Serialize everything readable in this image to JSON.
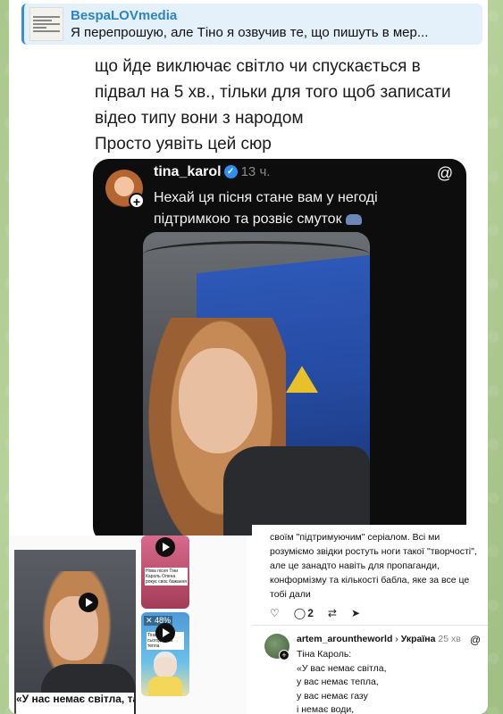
{
  "reply": {
    "author": "BespaLOVmedia",
    "snippet": "Я перепрошую, але Тіно я озвучив те, що пишуть в мер..."
  },
  "screenshot_text": {
    "line1": "що йде виключає світло чи спускається в",
    "line2": "підвал на 5 хв., тільки для того щоб записати",
    "line3": "відео типу вони з народом",
    "line4": "Просто уявіть цей сюр"
  },
  "threads_post": {
    "username": "tina_karol",
    "time": "13 ч.",
    "body": "Нехай ця пісня стане вам у негоді підтримкою та розвіє смуток"
  },
  "collage": {
    "left_caption": "«У нас немає світла, та у нас є",
    "thumb1_text": "Нова пісня Тіни Кароль Олена рокує своє бажання",
    "thumb2_badge": "✕ 48%",
    "thumb2_sticker": "Тіна Кароль сьогодні без тепла"
  },
  "threads_reply": {
    "prev_comment": "своїм \"підтримуючим\" серіалом. Всі ми розуміємо звідки ростуть ноги такої \"творчості\", але це занадто навіть для пропаганди, конформізму та кількості бабла, яке за все це тобі дали",
    "reply_count": "2",
    "username": "artem_arountheworld",
    "location": "Україна",
    "time": "25 хв",
    "text_line1": "Тіна Кароль:",
    "text_line2": "«У вас немає світла,",
    "text_line3": "у вас немає тепла,",
    "text_line4": "у вас немає газу",
    "text_line5": "і немає води,"
  },
  "colors": {
    "accent_blue": "#2d83c8",
    "verified_blue": "#2e8ff0",
    "background_green": "#a9c88c"
  }
}
